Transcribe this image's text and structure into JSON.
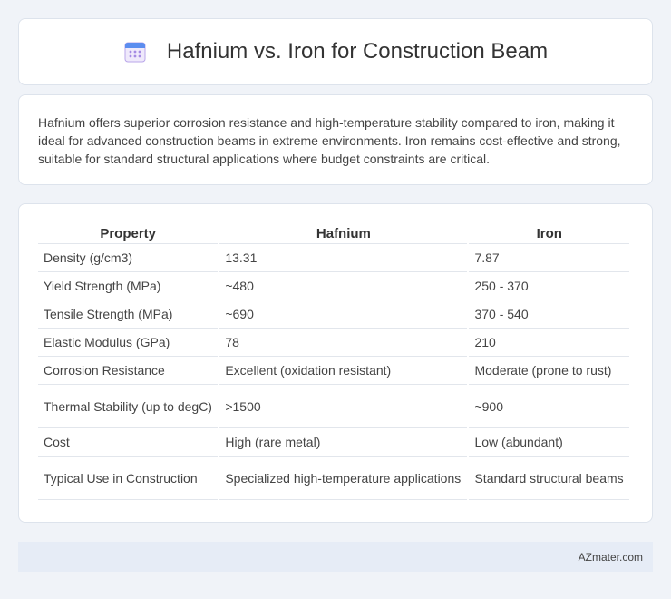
{
  "header": {
    "title": "Hafnium vs. Iron for Construction Beam",
    "icon": "calendar-icon"
  },
  "summary": {
    "text": "Hafnium offers superior corrosion resistance and high-temperature stability compared to iron, making it ideal for advanced construction beams in extreme environments. Iron remains cost-effective and strong, suitable for standard structural applications where budget constraints are critical."
  },
  "table": {
    "headers": [
      "Property",
      "Hafnium",
      "Iron"
    ],
    "rows": [
      [
        "Density (g/cm3)",
        "13.31",
        "7.87"
      ],
      [
        "Yield Strength (MPa)",
        "~480",
        "250 - 370"
      ],
      [
        "Tensile Strength (MPa)",
        "~690",
        "370 - 540"
      ],
      [
        "Elastic Modulus (GPa)",
        "78",
        "210"
      ],
      [
        "Corrosion Resistance",
        "Excellent (oxidation resistant)",
        "Moderate (prone to rust)"
      ],
      [
        "Thermal Stability (up to degC)",
        ">1500",
        "~900"
      ],
      [
        "Cost",
        "High (rare metal)",
        "Low (abundant)"
      ],
      [
        "Typical Use in Construction",
        "Specialized high-temperature applications",
        "Standard structural beams"
      ]
    ]
  },
  "footer": {
    "text": "AZmater.com"
  },
  "colors": {
    "background": "#f0f3f8",
    "icon_accent": "#8a6fd6",
    "icon_top": "#5b8def",
    "footer_bg": "#e6ecf6"
  }
}
